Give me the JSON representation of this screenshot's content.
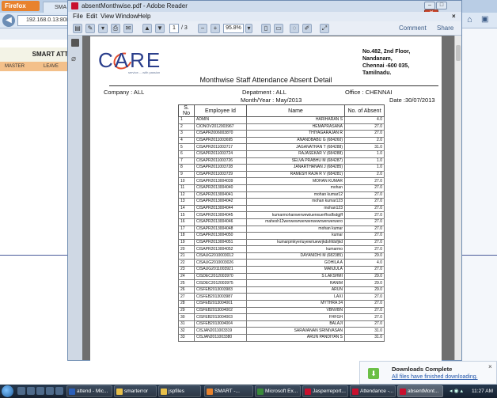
{
  "browser": {
    "app_button": "Firefox",
    "tab_label": "SMA",
    "url": "192.168.0.13:8080/",
    "smart_banner": "SMART ATT",
    "menu": [
      "MASTER",
      "LEAVE"
    ]
  },
  "reader": {
    "title": "absentMonthwise.pdf - Adobe Reader",
    "menu": [
      "File",
      "Edit",
      "View",
      "Window",
      "Help"
    ],
    "page_current": "1",
    "page_total": "/ 3",
    "zoom": "95.8%",
    "comment": "Comment",
    "share": "Share"
  },
  "report": {
    "logo_text": "CARE",
    "logo_tagline": "service.....with passion",
    "address": [
      "No.482, 2nd Floor,",
      "Nandanam,",
      "Chennai -600 035,",
      "Tamilnadu."
    ],
    "title": "Monthwise Staff Attendance Absent Detail",
    "company": "Company :  ALL",
    "department": "Depatment : ALL",
    "office": "Office :  CHENNAI",
    "month_year": "Month/Year : May/2013",
    "date": "Date :30/07/2013",
    "columns": [
      "S. No",
      "Employee Id",
      "Name",
      "No. of Absent"
    ],
    "rows": [
      [
        "1",
        "ADMIN",
        "HARIHARAN S",
        "4.0"
      ],
      [
        "2",
        "CIONOV2012003967",
        "HEMAPRASANA",
        "27.0"
      ],
      [
        "3",
        "CISAPR2006003870",
        "THIYAGARAJAN R",
        "27.0"
      ],
      [
        "4",
        "CISAPR2011003695",
        "ANANDBABU G (684260)",
        "2.0"
      ],
      [
        "5",
        "CISAPR2011003717",
        "JAGANATHAN T (684288)",
        "31.0"
      ],
      [
        "6",
        "CISAPR2011003724",
        "RAJASEKAR V (684288)",
        "1.0"
      ],
      [
        "7",
        "CISAPR2011003726",
        "SELVA PRABHU M (684287)",
        "1.0"
      ],
      [
        "8",
        "CISAPR2011003728",
        "JANARTHANAN J (684285)",
        "1.0"
      ],
      [
        "9",
        "CISAPR2011003729",
        "RAMESH RAJA R V (684281)",
        "2.0"
      ],
      [
        "10",
        "CISAPR2013004039",
        "MOHAN KUMAR",
        "27.0"
      ],
      [
        "11",
        "CISAPR2013004040",
        "mohan",
        "27.0"
      ],
      [
        "12",
        "CISAPR2013004041",
        "mohan kumar12",
        "27.0"
      ],
      [
        "13",
        "CISAPR2013004042",
        "mohan kumar123",
        "27.0"
      ],
      [
        "14",
        "CISAPR2013004044",
        "mohan123",
        "27.0"
      ],
      [
        "15",
        "CISAPR2013004045",
        "kumarmohanwerwewiuerwuerfhsdfsdgjff",
        "27.0"
      ],
      [
        "16",
        "CISAPR2013004046",
        "mahesh12werwewrwerwerwewrwerwerwero",
        "27.0"
      ],
      [
        "17",
        "CISAPR2013004048",
        "mohan kumar",
        "27.0"
      ],
      [
        "18",
        "CISAPR2013004050",
        "kumar",
        "27.0"
      ],
      [
        "19",
        "CISAPR2013004051",
        "kumarpmkyeriuyewriuewrjkdshfdsfjkd",
        "27.0"
      ],
      [
        "20",
        "CISAPR2013004052",
        "kumarmo",
        "27.0"
      ],
      [
        "21",
        "CISAUG2010003012",
        "DAYANIDHI M (682385)",
        "29.0"
      ],
      [
        "22",
        "CISAUG2010003026",
        "GOHILA A",
        "4.0"
      ],
      [
        "23",
        "CISAUG2011003921",
        "MANJULA",
        "27.0"
      ],
      [
        "24",
        "CISDEC2012003970",
        "S LAKSHMI",
        "29.0"
      ],
      [
        "25",
        "CISDEC2012003975",
        "RANIM",
        "29.0"
      ],
      [
        "26",
        "CISFEB2013003983",
        "ARUN",
        "29.0"
      ],
      [
        "27",
        "CISFEB2013003987",
        "LAXI",
        "27.0"
      ],
      [
        "28",
        "CISFEB2013004001",
        "MYTHRA 34",
        "27.0"
      ],
      [
        "29",
        "CISFEB2013004002",
        "VBNVBN",
        "27.0"
      ],
      [
        "30",
        "CISFEB2013004003",
        "FHFGH",
        "27.0"
      ],
      [
        "31",
        "CISFEB2013004004",
        "BALAJI",
        "27.0"
      ],
      [
        "32",
        "CISJAN2011003319",
        "SARAVANAN SRINIVASAN",
        "31.0"
      ],
      [
        "33",
        "CISJAN2011003380",
        "ARUN PANDIYAN S",
        "31.0"
      ]
    ]
  },
  "download": {
    "title": "Downloads Complete",
    "subtitle": "All files have finished downloading."
  },
  "taskbar": {
    "tasks": [
      "attend - Mic...",
      "smarterror",
      "jspfiles",
      "SMART -...",
      "Microsoft Ex...",
      "Jasperreport...",
      "Attendance -...",
      "absentMont..."
    ],
    "clock": "11:27 AM"
  },
  "colors": {
    "reader_bg": "#6e6e6e",
    "logo_blue": "#2b3f8c",
    "logo_orange": "#e44d2e",
    "firefox_orange": "#e8822d"
  }
}
